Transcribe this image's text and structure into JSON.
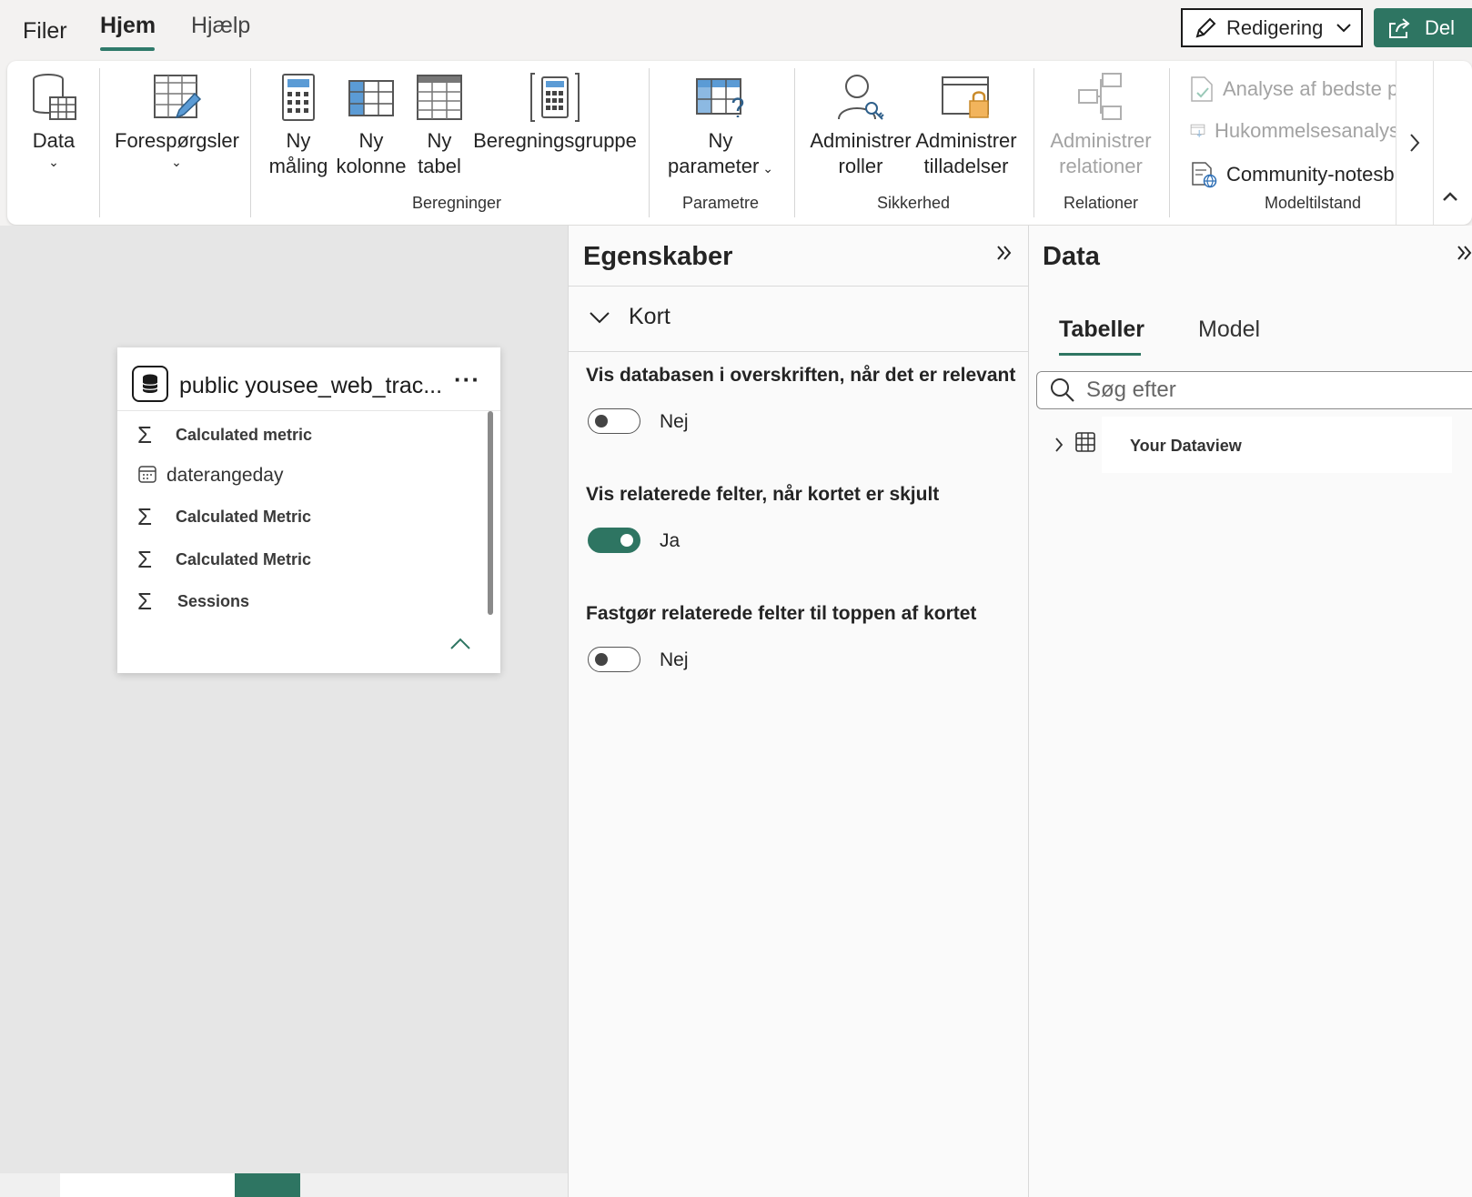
{
  "topbar": {
    "tabs": [
      "Filer",
      "Hjem",
      "Hjælp"
    ],
    "edit_label": "Redigering",
    "share_label": "Del"
  },
  "ribbon": {
    "data_label": "Data",
    "queries_label": "Forespørgsler",
    "new_measure": [
      "Ny",
      "måling"
    ],
    "new_column": [
      "Ny",
      "kolonne"
    ],
    "new_table": [
      "Ny",
      "tabel"
    ],
    "calc_group": "Beregningsgruppe",
    "group_calculations": "Beregninger",
    "new_parameter": [
      "Ny",
      "parameter"
    ],
    "group_parameters": "Parametre",
    "manage_roles": [
      "Administrer",
      "roller"
    ],
    "manage_permissions": [
      "Administrer",
      "tilladelser"
    ],
    "group_security": "Sikkerhed",
    "manage_relations": [
      "Administrer",
      "relationer"
    ],
    "group_relations": "Relationer",
    "best_practice": "Analyse af bedste p",
    "memory_analysis": "Hukommelsesanalys",
    "community_notes": "Community-notesb",
    "group_model_state": "Modeltilstand"
  },
  "card": {
    "title": "public yousee_web_trac...",
    "more": "···",
    "fields": [
      {
        "type": "measure",
        "label": "Calculated metric"
      },
      {
        "type": "date",
        "label": "daterangeday"
      },
      {
        "type": "measure",
        "label": "Calculated Metric"
      },
      {
        "type": "measure",
        "label": "Calculated Metric"
      },
      {
        "type": "measure",
        "label": "Sessions"
      }
    ]
  },
  "properties": {
    "title": "Egenskaber",
    "section": "Kort",
    "options": [
      {
        "label": "Vis databasen i overskriften, når det er relevant",
        "state": false,
        "state_text": "Nej"
      },
      {
        "label": "Vis relaterede felter, når kortet er skjult",
        "state": true,
        "state_text": "Ja"
      },
      {
        "label": "Fastgør relaterede felter til toppen af kortet",
        "state": false,
        "state_text": "Nej"
      }
    ]
  },
  "data_pane": {
    "title": "Data",
    "tabs": [
      "Tabeller",
      "Model"
    ],
    "search_placeholder": "Søg efter",
    "tree_items": [
      "Your Dataview"
    ]
  },
  "colors": {
    "accent": "#2e7562",
    "canvas": "#e6e6e6",
    "pane": "#fafafa"
  }
}
